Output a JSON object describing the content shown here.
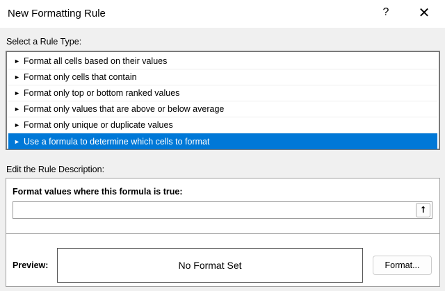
{
  "title": "New Formatting Rule",
  "help_label": "?",
  "close_label": "✕",
  "rule_type_label": "Select a Rule Type:",
  "rule_types": [
    {
      "label": "Format all cells based on their values"
    },
    {
      "label": "Format only cells that contain"
    },
    {
      "label": "Format only top or bottom ranked values"
    },
    {
      "label": "Format only values that are above or below average"
    },
    {
      "label": "Format only unique or duplicate values"
    },
    {
      "label": "Use a formula to determine which cells to format",
      "selected": true
    }
  ],
  "arrow_glyph": "►",
  "description_label": "Edit the Rule Description:",
  "formula_label": "Format values where this formula is true:",
  "formula_value": "",
  "ref_button_glyph": "⭡",
  "preview_label": "Preview:",
  "preview_text": "No Format Set",
  "format_button": "Format..."
}
